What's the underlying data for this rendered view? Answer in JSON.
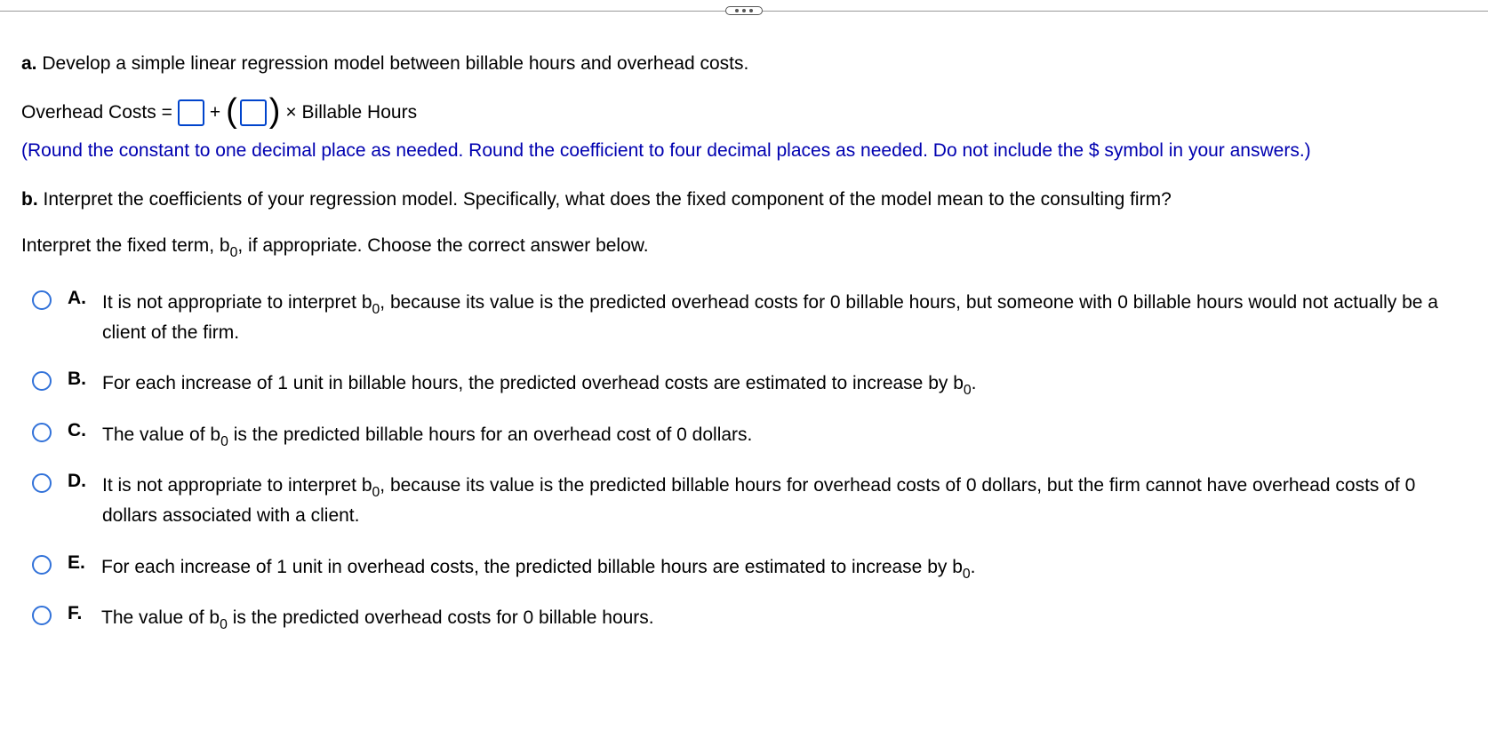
{
  "partA": {
    "letter": "a.",
    "prompt": " Develop a simple linear regression model between billable hours and overhead costs.",
    "equation": {
      "lhs": "Overhead Costs =",
      "plus": "+",
      "times_rhs": "× Billable Hours"
    },
    "instruction": "(Round the constant to one decimal place as needed. Round the coefficient to four decimal places as needed. Do not include the $ symbol in your answers.)"
  },
  "partB": {
    "letter": "b.",
    "prompt": " Interpret the coefficients of your regression model. Specifically, what does the fixed component of the model mean to the consulting firm?",
    "subprompt_pre": "Interpret the fixed term, b",
    "subprompt_sub": "0",
    "subprompt_post": ", if appropriate. Choose the correct answer below."
  },
  "options": [
    {
      "label": "A.",
      "segments": [
        {
          "t": "It is not appropriate to interpret b"
        },
        {
          "sub": "0"
        },
        {
          "t": ", because its value is the predicted overhead costs for  0 billable hours, but someone with 0 billable hours would not actually be a client of the firm."
        }
      ]
    },
    {
      "label": "B.",
      "segments": [
        {
          "t": "For each increase of 1 unit in billable hours, the predicted overhead costs are estimated to increase by b"
        },
        {
          "sub": "0"
        },
        {
          "t": "."
        }
      ]
    },
    {
      "label": "C.",
      "segments": [
        {
          "t": "The value of b"
        },
        {
          "sub": "0"
        },
        {
          "t": " is the predicted billable hours for an overhead cost of 0 dollars."
        }
      ]
    },
    {
      "label": "D.",
      "segments": [
        {
          "t": "It is not appropriate to interpret b"
        },
        {
          "sub": "0"
        },
        {
          "t": ", because its value is the predicted billable hours for  overhead costs of 0 dollars, but the firm cannot have overhead costs of 0 dollars associated with a client."
        }
      ]
    },
    {
      "label": "E.",
      "segments": [
        {
          "t": "For each increase of 1 unit in overhead costs, the predicted billable hours are estimated to increase by b"
        },
        {
          "sub": "0"
        },
        {
          "t": "."
        }
      ]
    },
    {
      "label": "F.",
      "segments": [
        {
          "t": "The value of b"
        },
        {
          "sub": "0"
        },
        {
          "t": " is the predicted overhead costs for 0 billable hours."
        }
      ]
    }
  ]
}
